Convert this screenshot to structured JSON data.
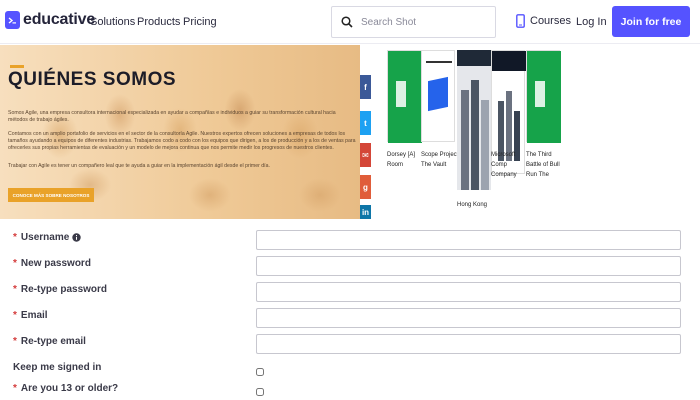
{
  "nav": {
    "brand": "educative",
    "links": [
      "Solutions",
      "Products",
      "Pricing"
    ],
    "search_placeholder": "Search Shot",
    "courses": "Courses",
    "login": "Log In",
    "join": "Join for free",
    "accent": "#5553ff"
  },
  "hero": {
    "title": "QUIÉNES SOMOS",
    "paragraphs": [
      "Somos Agile, una empresa consultora internacional especializada en ayudar a compañías e individuos a guiar su transformación cultural hacia métodos de trabajo ágiles.",
      "Contamos con un amplio portafolio de servicios en el sector de la consultoría Agile. Nuestros expertos ofrecen soluciones a empresas de todos los tamaños ayudando a equipos de diferentes industrias. Trabajamos codo a codo con los equipos que dirigen, a los de producción y a los de ventas para ofrecerles sus propias herramientas de evaluación y un modelo de mejora continua que nos permite medir los progresos de nuestros clientes.",
      "Trabajar con Agile es tener un compañero leal que te ayuda a guiar en la implementación ágil desde el primer día."
    ],
    "cta": "CONOCE MÁS SOBRE NOSOTROS",
    "accent": "#e9a229"
  },
  "social": [
    {
      "icon": "facebook-icon",
      "glyph": "f",
      "color": "#3b5998"
    },
    {
      "icon": "twitter-icon",
      "glyph": "t",
      "color": "#1da1f2"
    },
    {
      "icon": "email-icon",
      "glyph": "✉",
      "color": "#d44638"
    },
    {
      "icon": "google-plus-icon",
      "glyph": "g",
      "color": "#e05d3a"
    },
    {
      "icon": "linkedin-icon",
      "glyph": "in",
      "color": "#0e76a8"
    }
  ],
  "books": [
    {
      "caption": "Dorsey [A] Room",
      "color": "#16a34a"
    },
    {
      "caption": "Scope Project The Vault",
      "color": "#2563eb"
    },
    {
      "caption": "Hong Kong",
      "color": "#6b7280"
    },
    {
      "caption": "Microsoft Comp Company",
      "color": "#4b5563"
    },
    {
      "caption": "The Third Battle of Bull Run The",
      "color": "#16a34a"
    }
  ],
  "form": {
    "fields": [
      {
        "label": "Username",
        "required": true,
        "info": true,
        "value": ""
      },
      {
        "label": "New password",
        "required": true,
        "info": false,
        "value": ""
      },
      {
        "label": "Re-type password",
        "required": true,
        "info": false,
        "value": ""
      },
      {
        "label": "Email",
        "required": true,
        "info": false,
        "value": ""
      },
      {
        "label": "Re-type email",
        "required": true,
        "info": false,
        "value": ""
      }
    ],
    "checks": [
      {
        "label": "Keep me signed in",
        "required": false,
        "checked": false
      },
      {
        "label": "Are you 13 or older?",
        "required": true,
        "checked": false
      }
    ]
  }
}
